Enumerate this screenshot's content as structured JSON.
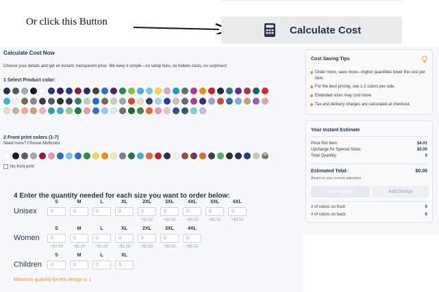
{
  "banner": {
    "note": "Or click this Button",
    "calc_label": "Calculate Cost"
  },
  "header": {
    "title": "Calculate Cost Now",
    "subtitle": "Choose your details and get an instant, transparent price. We keep it simple—no setup fees, no hidden costs, no surprises!",
    "select_color": "1 Select Product color:"
  },
  "product_colors": [
    [
      "#24314f",
      "#555b63",
      "#a7aab0",
      "#1a1a1a",
      "#ffffff",
      "#223a7a",
      "#3a1f5a",
      "#2b3b8f",
      "#8b1e3f",
      "#2e2a6f",
      "#3e4a36",
      "#2f6bd1",
      "#4a2b5e",
      "#2f8b3b",
      "#7ec442",
      "#4fb0d8",
      "#7bc7e8",
      "#f4d44d",
      "#e6a6c2",
      "#1d9bd1",
      "#6a6d70",
      "#b03a8f",
      "#f08c1c",
      "#c51f30",
      "#1e2a44",
      "#2a7a7a",
      "#6c2c9a",
      "#a23b3b",
      "#0f6a5e",
      "#d62e2e"
    ],
    [
      "#3fb8c8",
      "#f3f3f0",
      "#7a6a56",
      "#8a8a8a",
      "#3c3c3c",
      "#5a5a5a",
      "#2d2d2d",
      "#3a3a5a",
      "#2c8a5a",
      "#bcd6a2",
      "#1e73c9",
      "#7a6a48",
      "#d8cba8",
      "#9aa6b8",
      "#d64a2a",
      "#e9dcc3",
      "#3a3f78",
      "#a7d0e8",
      "#1e4a9a",
      "#c9c3b8",
      "#5a6a8a",
      "#a44a7a",
      "#2a3a6a",
      "#a0a7b2",
      "#cf4b2a",
      "#3a6a9a",
      "#7bb1d8",
      "#caa07a",
      "#9b59c8",
      "#e7a3b3"
    ],
    [
      "#e7dcc8",
      "#c6b3a0",
      "#f2a99b",
      "#d1a080",
      "#e8b7c0",
      "#2ca6a2",
      "#4aa9d6",
      "#8ccf8a",
      "#1d7a4a",
      "#e89aa8",
      "#3a6fbf",
      "#9cc4e8",
      "#d7ecf3",
      "#6b6f72",
      "#1e6a3a",
      "#3c8a3a",
      "#e36a2a",
      "#ea96b8",
      "#e6c4c9",
      "#3b4a9a",
      "#2b5d6a",
      "#7bd1c8",
      "#c8b7e8"
    ]
  ],
  "front_print": {
    "title": "2 Front print colors (1-7)",
    "multi": "Need more? Choose Multicolor.",
    "no_front": "No front print",
    "colors": [
      "#ffffff",
      "#1a1a1a",
      "#5a5f65",
      "#a7aab0",
      "#8b1e3f",
      "#e39bb0",
      "#1e73c9",
      "#7bc7e8",
      "#2f6bd1",
      "#2f8b3b",
      "#f4d44d",
      "#f08c1c",
      "#f5e6b8",
      "#7a7f85",
      "#1d7a4a",
      "#3fb8c8",
      "#e36a2a",
      "#c51f30",
      "#24314f",
      "#f1f1ee",
      "#8a5a3a",
      "#7a3a4a",
      "#e36a2a",
      "#3a3f50",
      "#4ab84a",
      "#2d2d2d",
      "#24314f",
      "#2c3a8a",
      "#c8c8c8"
    ]
  },
  "quantity": {
    "heading": "4 Enter the quantity needed for each size you want to order below:",
    "placeholder": "0",
    "unisex": {
      "label": "Unisex",
      "sizes": [
        "S",
        "M",
        "L",
        "XL",
        "2XL",
        "3XL",
        "4XL",
        "5XL",
        "6XL"
      ],
      "upcharges": [
        "",
        "",
        "",
        "",
        "+$2.50",
        "+$3.50",
        "+$4.50",
        "+$5.50",
        "+$6.50"
      ]
    },
    "women": {
      "label": "Women",
      "sizes": [
        "S",
        "M",
        "L",
        "XL",
        "2XL",
        "3XL",
        "4XL"
      ],
      "upcharges": [
        "+$1.00",
        "+$1.00",
        "+$1.00",
        "+$1.00",
        "+$3.50",
        "+$4.50",
        "+$5.50"
      ]
    },
    "children": {
      "label": "Children",
      "sizes": [
        "S",
        "M",
        "L",
        "XL"
      ]
    },
    "minimum": "Minimum quantity for this design is 1"
  },
  "tips": {
    "title": "Cost Saving Tips",
    "items": [
      "Order more, save more—higher quantities lower the cost per item.",
      "For the best pricing, use 1-2 colors per side.",
      "Extended sizes may cost more.",
      "Tax and delivery charges are calculated at checkout."
    ]
  },
  "estimate": {
    "title": "Your Instant Estimate",
    "price_label": "Price Per Item:",
    "price_value": "$4.01",
    "upcharge_label": "Upcharge for Special Sizes:",
    "upcharge_value": "$0.00",
    "qty_label": "Total Quantity:",
    "qty_value": "0",
    "total_label": "Estimated Total:",
    "total_value": "$0.00",
    "based": "Based on your current selections",
    "save_quote": "Save Quote",
    "add_design": "Add Design",
    "front_colors_label": "# of colors on front:",
    "front_colors_value": "0",
    "back_colors_label": "# of colors on back:",
    "back_colors_value": "0"
  },
  "colors": {
    "brand": "#24314f",
    "accent": "#f08a24"
  }
}
